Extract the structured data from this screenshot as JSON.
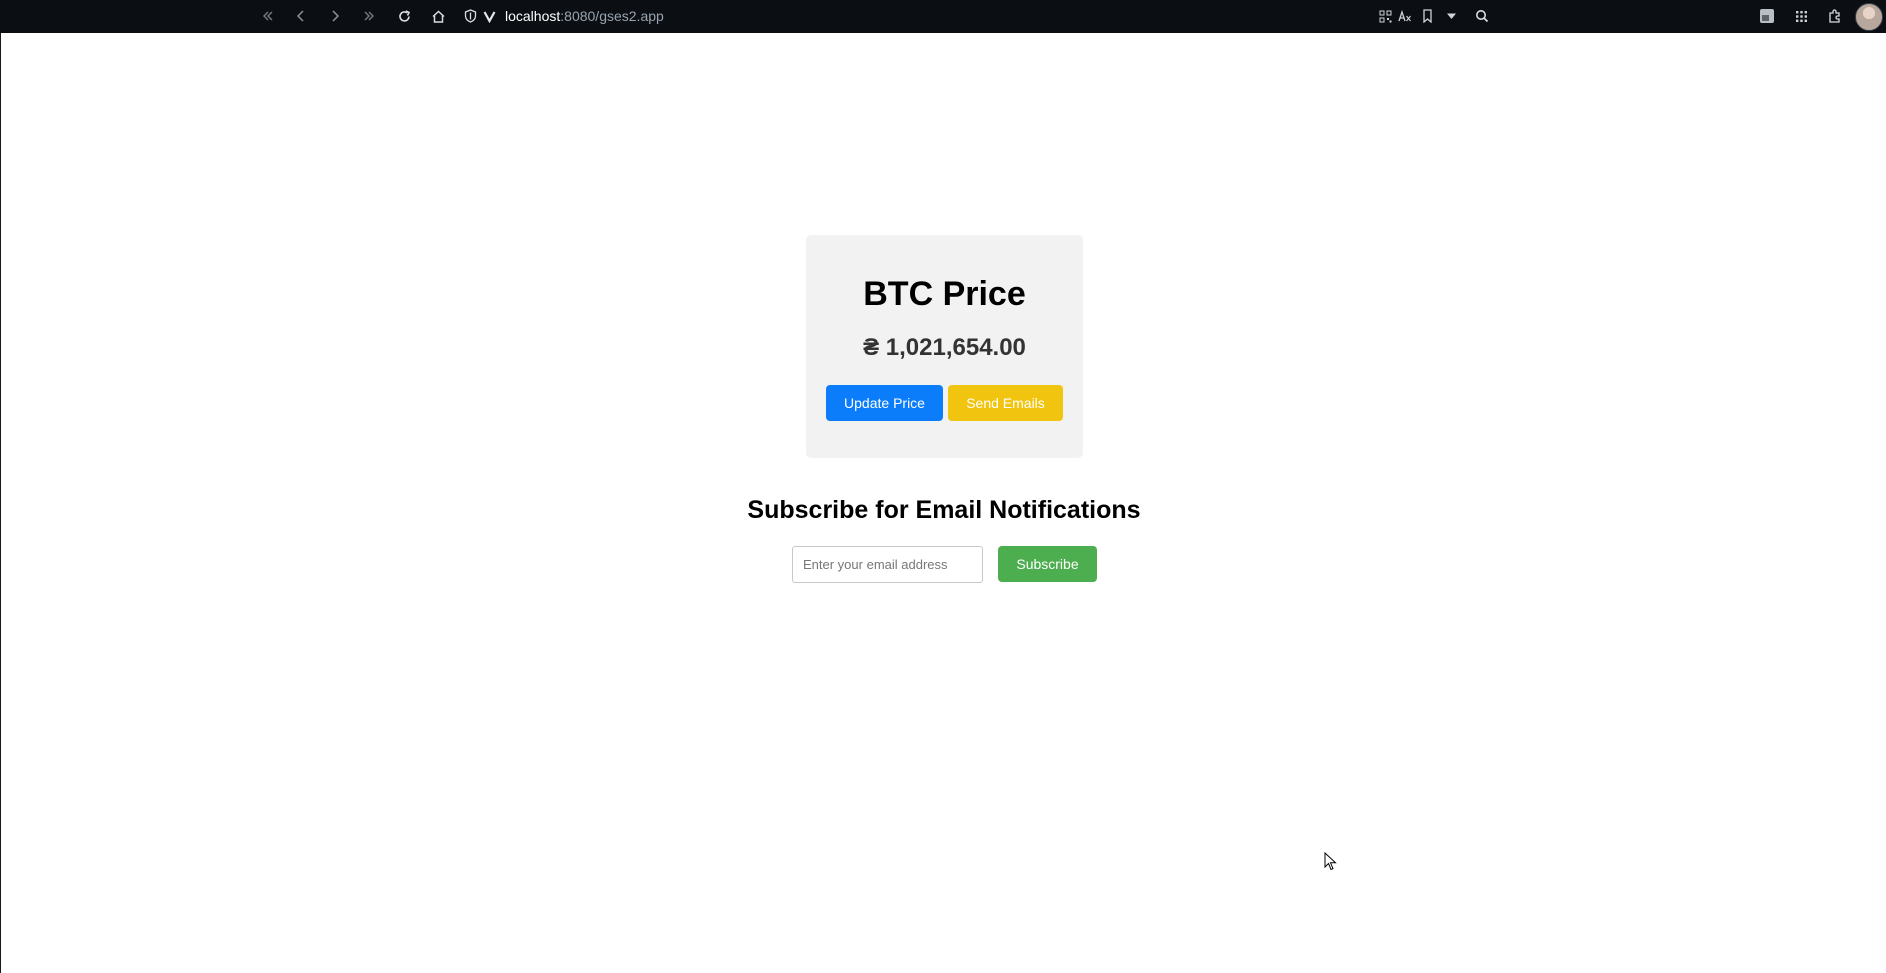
{
  "browser": {
    "url_host": "localhost",
    "url_rest": ":8080/gses2.app",
    "icons": [
      "rewind-icon",
      "back-icon",
      "forward-icon",
      "fast-forward-icon",
      "reload-icon",
      "home-icon",
      "shield-icon",
      "vivaldi-icon",
      "qr-code-icon",
      "translate-icon",
      "bookmark-icon",
      "dropdown-icon",
      "search-icon",
      "window-icon",
      "apps-icon",
      "extensions-icon",
      "avatar"
    ]
  },
  "card": {
    "title": "BTC Price",
    "price": "₴ 1,021,654.00",
    "update_label": "Update Price",
    "send_label": "Send Emails"
  },
  "subscribe": {
    "title": "Subscribe for Email Notifications",
    "placeholder": "Enter your email address",
    "button_label": "Subscribe"
  },
  "colors": {
    "update_button": "#0b7dfa",
    "send_button": "#f1c40f",
    "subscribe_button": "#4cae4f",
    "card_background": "#f2f2f2"
  }
}
